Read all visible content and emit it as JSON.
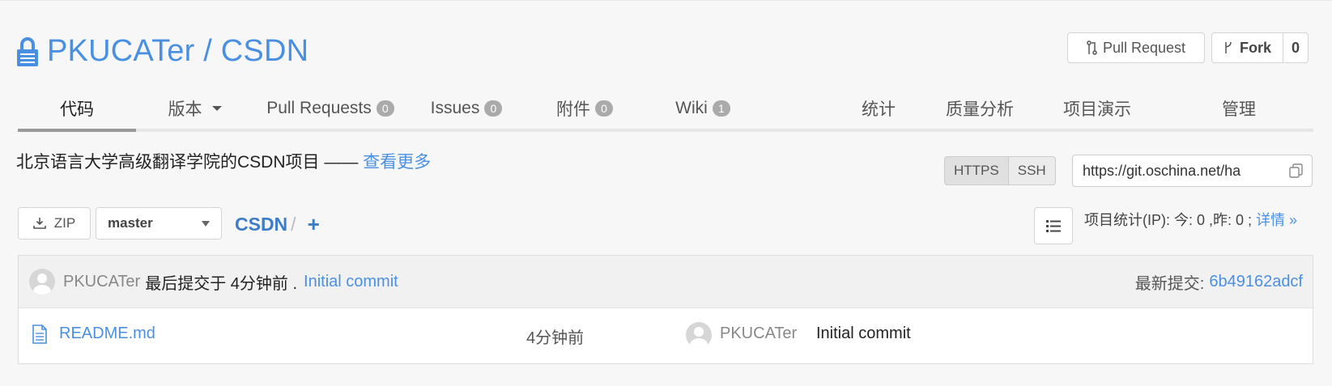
{
  "repo": {
    "name": "PKUCATer / CSDN",
    "lock_icon": "lock-icon"
  },
  "header": {
    "pull_request_label": "Pull Request",
    "fork_label": "Fork",
    "fork_count": "0"
  },
  "tabs": [
    {
      "label": "代码",
      "active": true
    },
    {
      "label": "版本"
    },
    {
      "label": "Pull Requests",
      "badge": "0"
    },
    {
      "label": "Issues",
      "badge": "0"
    },
    {
      "label": "附件",
      "badge": "0"
    },
    {
      "label": "Wiki",
      "badge": "1"
    },
    {
      "label": "统计"
    },
    {
      "label": "质量分析"
    },
    {
      "label": "项目演示"
    },
    {
      "label": "管理"
    }
  ],
  "description": {
    "text": "北京语言大学高级翻译学院的CSDN项目 —— ",
    "more_link": "查看更多"
  },
  "clone": {
    "https_label": "HTTPS",
    "ssh_label": "SSH",
    "url": "https://git.oschina.net/ha"
  },
  "toolbar": {
    "zip_label": "ZIP",
    "branch": "master",
    "crumb_repo": "CSDN",
    "crumb_sep": "/",
    "add_label": "+"
  },
  "stats": {
    "text": "项目统计(IP): 今: 0 ,昨: 0 ; ",
    "link": "详情 »"
  },
  "last_commit": {
    "author": "PKUCATer",
    "text": "最后提交于 4分钟前 .",
    "message": "Initial commit",
    "latest_label": "最新提交:",
    "sha": "6b49162adcf"
  },
  "files": [
    {
      "name": "README.md",
      "time": "4分钟前",
      "author": "PKUCATer",
      "message": "Initial commit"
    }
  ],
  "colors": {
    "link": "#4a90e2",
    "badge": "#aaaaaa"
  }
}
